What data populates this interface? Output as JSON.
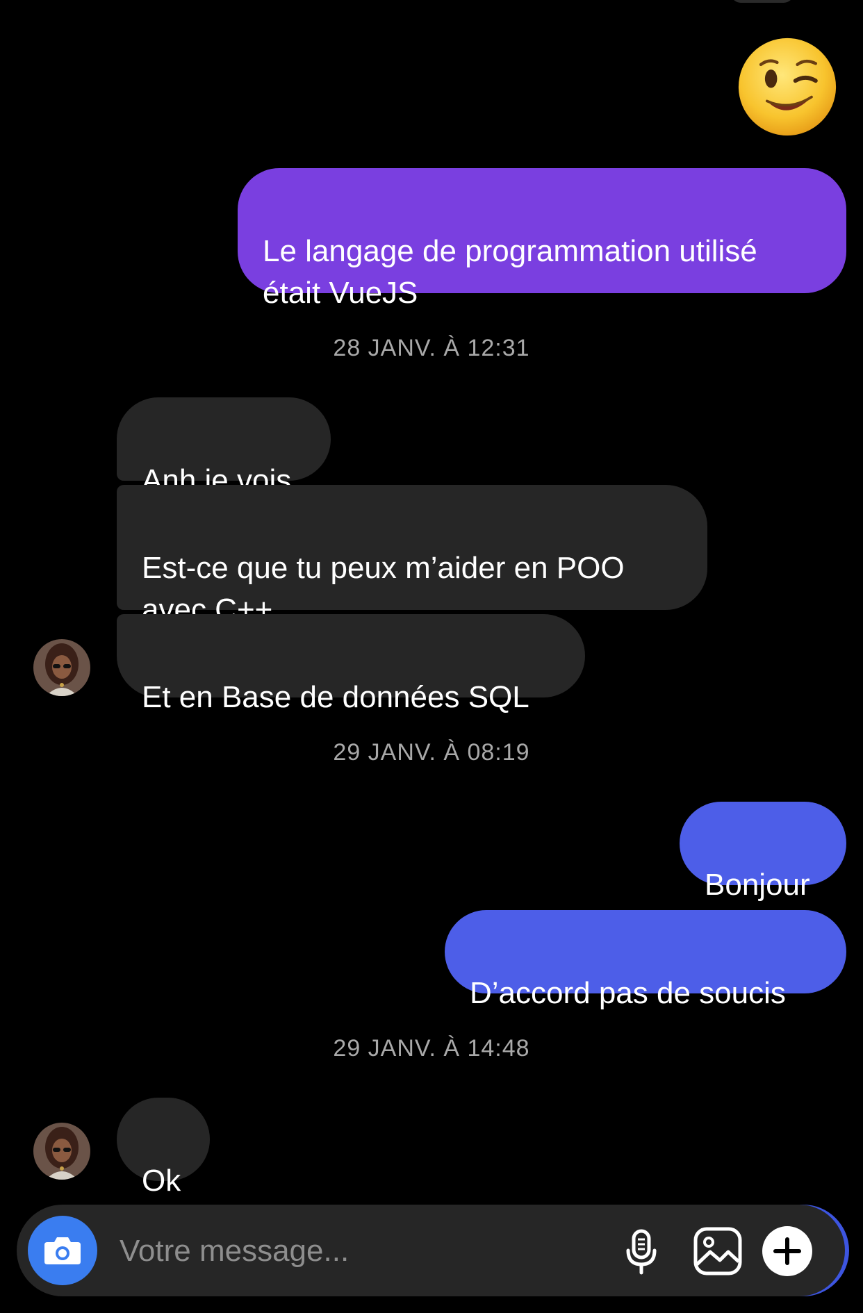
{
  "conversation": {
    "reaction_emoji": "winking-face",
    "messages": [
      {
        "text": "Le langage de programmation utilisé\nétait VueJS"
      },
      {
        "text": "Anh je vois"
      },
      {
        "text": "Est-ce que tu peux m’aider en POO\navec C++"
      },
      {
        "text": "Et en Base de données SQL"
      },
      {
        "text": "Bonjour"
      },
      {
        "text": "D’accord pas de soucis"
      },
      {
        "text": "Ok"
      }
    ],
    "timestamps": [
      "28 JANV. À 12:31",
      "29 JANV. À 08:19",
      "29 JANV. À 14:48"
    ]
  },
  "composer": {
    "placeholder": "Votre message...",
    "camera_icon": "camera-icon",
    "mic_icon": "microphone-icon",
    "gallery_icon": "image-icon",
    "plus_icon": "plus-icon"
  },
  "colors": {
    "background": "#000000",
    "outgoing_purple": "#7a3fe0",
    "outgoing_blue": "#4d5ee8",
    "incoming": "#262626",
    "camera_button": "#3a7df0",
    "timestamp": "#a9a9a9"
  }
}
